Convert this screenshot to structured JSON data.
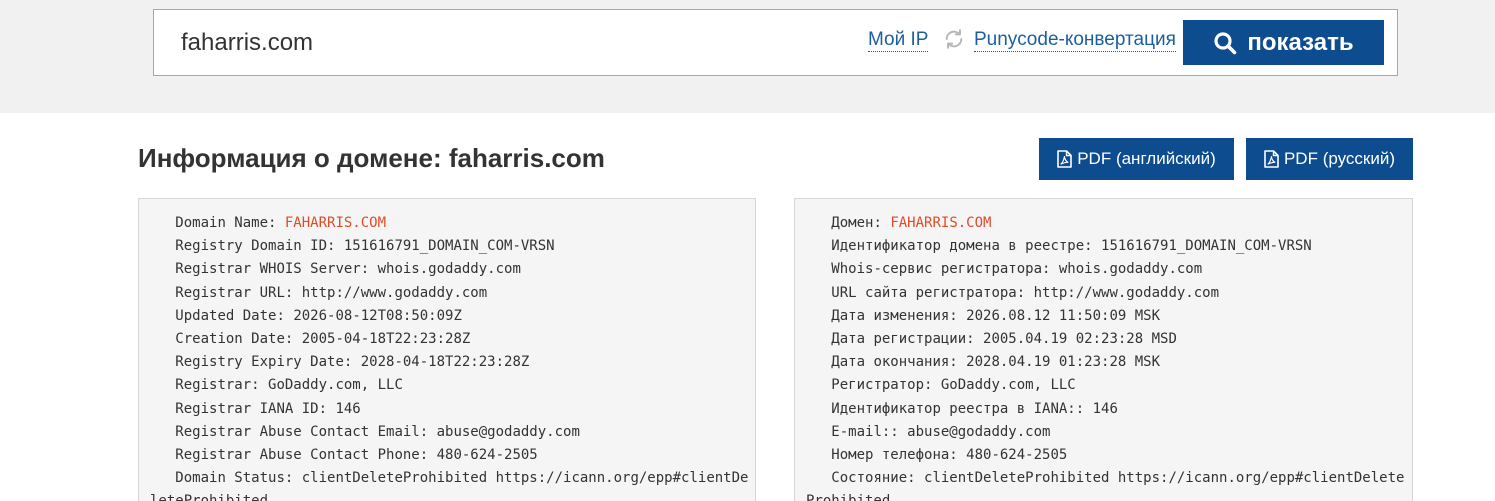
{
  "search": {
    "value": "faharris.com",
    "my_ip_label": "Мой IP",
    "punycode_label": "Punycode-конвертация",
    "show_button_label": "показать"
  },
  "header": {
    "title_prefix": "Информация о домене: ",
    "title_domain": "faharris.com",
    "pdf_en_label": "PDF (английский)",
    "pdf_ru_label": "PDF (русский)"
  },
  "whois_en": [
    {
      "label": "   Domain Name: ",
      "value": "FAHARRIS.COM",
      "highlight": true
    },
    {
      "label": "   Registry Domain ID: ",
      "value": "151616791_DOMAIN_COM-VRSN"
    },
    {
      "label": "   Registrar WHOIS Server: ",
      "value": "whois.godaddy.com"
    },
    {
      "label": "   Registrar URL: ",
      "value": "http://www.godaddy.com"
    },
    {
      "label": "   Updated Date: ",
      "value": "2026-08-12T08:50:09Z"
    },
    {
      "label": "   Creation Date: ",
      "value": "2005-04-18T22:23:28Z"
    },
    {
      "label": "   Registry Expiry Date: ",
      "value": "2028-04-18T22:23:28Z"
    },
    {
      "label": "   Registrar: ",
      "value": "GoDaddy.com, LLC"
    },
    {
      "label": "   Registrar IANA ID: ",
      "value": "146"
    },
    {
      "label": "   Registrar Abuse Contact Email: ",
      "value": "abuse@godaddy.com"
    },
    {
      "label": "   Registrar Abuse Contact Phone: ",
      "value": "480-624-2505"
    },
    {
      "label": "   Domain Status: ",
      "value": "clientDeleteProhibited https://icann.org/epp#clientDeleteProhibited"
    }
  ],
  "whois_ru": [
    {
      "label": "   Домен: ",
      "value": "FAHARRIS.COM",
      "highlight": true
    },
    {
      "label": "   Идентификатор домена в реестре: ",
      "value": "151616791_DOMAIN_COM-VRSN"
    },
    {
      "label": "   Whois-сервис регистратора: ",
      "value": "whois.godaddy.com"
    },
    {
      "label": "   URL сайта регистратора: ",
      "value": "http://www.godaddy.com"
    },
    {
      "label": "   Дата изменения: ",
      "value": "2026.08.12 11:50:09 MSK"
    },
    {
      "label": "   Дата регистрации: ",
      "value": "2005.04.19 02:23:28 MSD"
    },
    {
      "label": "   Дата окончания: ",
      "value": "2028.04.19 01:23:28 MSK"
    },
    {
      "label": "   Регистратор: ",
      "value": "GoDaddy.com, LLC"
    },
    {
      "label": "   Идентификатор реестра в IANA:: ",
      "value": "146"
    },
    {
      "label": "   E-mail:: ",
      "value": "abuse@godaddy.com"
    },
    {
      "label": "   Номер телефона: ",
      "value": "480-624-2505"
    },
    {
      "label": "   Состояние: ",
      "value": "clientDeleteProhibited https://icann.org/epp#clientDeleteProhibited"
    }
  ],
  "colors": {
    "accent": "#0d4c8f",
    "link": "#1c5f9e",
    "highlight": "#e04b2a"
  }
}
